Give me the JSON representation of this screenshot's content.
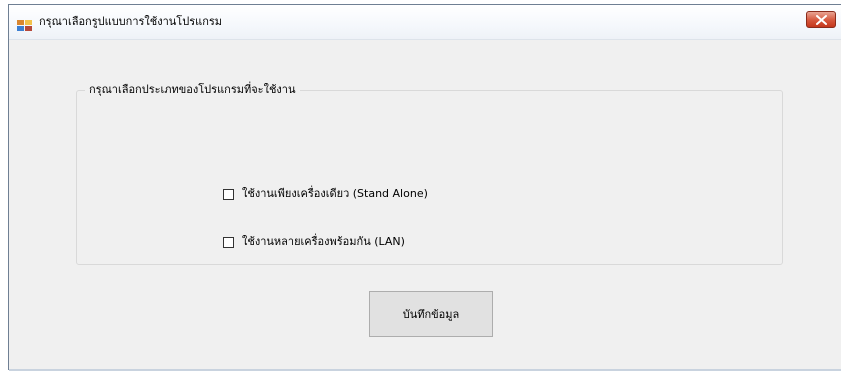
{
  "window": {
    "title": "กรุณาเลือกรูปแบบการใช้งานโปรแกรม",
    "icon": "app-window-icon",
    "close_icon": "close-icon"
  },
  "group": {
    "legend": "กรุณาเลือกประเภทของโปรแกรมที่จะใช้งาน",
    "options": [
      {
        "label": "ใช้งานเพียงเครื่องเดียว (Stand Alone)",
        "checked": false
      },
      {
        "label": "ใช้งานหลายเครื่องพร้อมกัน (LAN)",
        "checked": false
      }
    ]
  },
  "actions": {
    "save_label": "บันทึกข้อมูล"
  },
  "colors": {
    "client_background": "#f0f0f0",
    "close_button": "#d6573c",
    "button_face": "#e1e1e1"
  }
}
